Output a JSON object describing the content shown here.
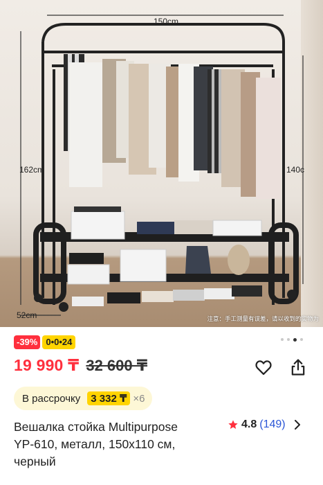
{
  "photo": {
    "dim_width": "150cm",
    "dim_left": "162cm",
    "dim_right": "140c",
    "dim_bottom": "52cm",
    "note": "注意：手工测量有误差，请以收到的实物为"
  },
  "gallery": {
    "count": 4,
    "active_index": 2
  },
  "badges": {
    "discount": "-39%",
    "installment": "0•0•24"
  },
  "price": {
    "current": "19 990 ₸",
    "old": "32 600 ₸"
  },
  "actions": {
    "favorite_icon": "heart-icon",
    "share_icon": "share-icon"
  },
  "installment": {
    "label": "В рассрочку",
    "amount": "3 332 ₸",
    "times": "×6"
  },
  "product": {
    "title_line1": "Вешалка стойка Multipurpose",
    "title_line2": "YP-610, металл, 150х110 см,",
    "title_line3": "черный"
  },
  "rating": {
    "score": "4.8",
    "count": "(149)"
  },
  "colors": {
    "accent_red": "#ff2f3d",
    "installment_yellow": "#ffd400",
    "link_blue": "#2a55d6"
  }
}
